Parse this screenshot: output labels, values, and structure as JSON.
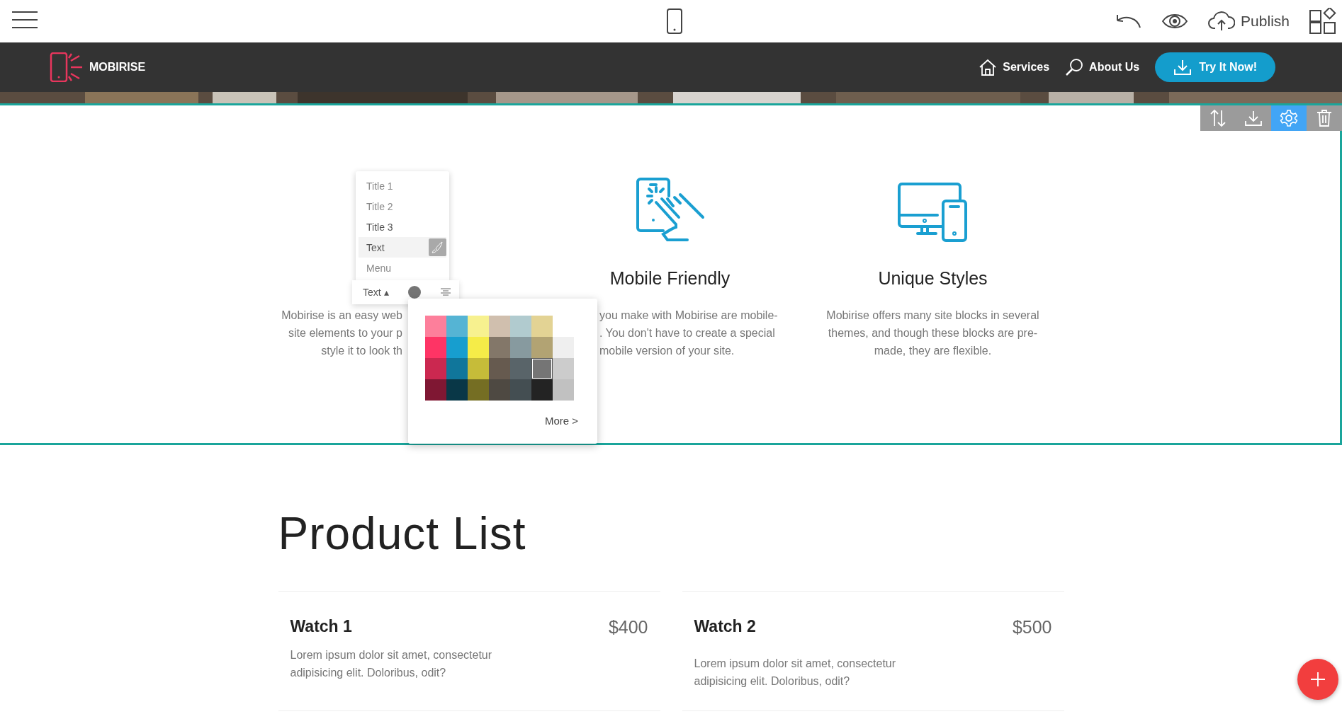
{
  "editor_bar": {
    "publish": "Publish"
  },
  "site_nav": {
    "brand": "MOBIRISE",
    "links": [
      {
        "label": "Services"
      },
      {
        "label": "About Us"
      }
    ],
    "cta": "Try It Now!"
  },
  "block_toolbar": [
    {
      "kind": "move",
      "selected": false
    },
    {
      "kind": "save",
      "selected": false
    },
    {
      "kind": "settings",
      "selected": true
    },
    {
      "kind": "delete",
      "selected": false
    }
  ],
  "style_menu": [
    {
      "label": "Title 1",
      "selected": false
    },
    {
      "label": "Title 2",
      "selected": false
    },
    {
      "label": "Title 3",
      "selected": false
    },
    {
      "label": "Text",
      "selected": true
    },
    {
      "label": "Menu",
      "selected": false
    }
  ],
  "text_toolbar": {
    "style": "Text ▴",
    "color": "#757575"
  },
  "palette": {
    "rows": [
      [
        {
          "color": "#fd7f9b",
          "selected": false
        },
        {
          "color": "#55b4d4",
          "selected": false
        },
        {
          "color": "#f7f18f",
          "selected": false
        },
        {
          "color": "#d0bfae",
          "selected": false
        },
        {
          "color": "#b1cbcf",
          "selected": false
        },
        {
          "color": "#e3d394",
          "selected": false
        }
      ],
      [
        {
          "color": "#fe3465",
          "selected": false
        },
        {
          "color": "#179ecf",
          "selected": false
        },
        {
          "color": "#f5ec48",
          "selected": false
        },
        {
          "color": "#837769",
          "selected": false
        },
        {
          "color": "#879a9f",
          "selected": false
        },
        {
          "color": "#b2a373",
          "selected": false
        },
        {
          "color": "#efefef",
          "selected": false
        }
      ],
      [
        {
          "color": "#cb2850",
          "selected": false
        },
        {
          "color": "#10769b",
          "selected": false
        },
        {
          "color": "#c6bc39",
          "selected": false
        },
        {
          "color": "#665a4f",
          "selected": false
        },
        {
          "color": "#596469",
          "selected": false
        },
        {
          "color": "#757575",
          "selected": true
        },
        {
          "color": "#cccccc",
          "selected": false
        }
      ],
      [
        {
          "color": "#7f1733",
          "selected": false
        },
        {
          "color": "#093747",
          "selected": false
        },
        {
          "color": "#756e23",
          "selected": false
        },
        {
          "color": "#4e4942",
          "selected": false
        },
        {
          "color": "#444e52",
          "selected": false
        },
        {
          "color": "#232323",
          "selected": false
        },
        {
          "color": "#c1c1c1",
          "selected": false
        }
      ]
    ],
    "more": "More >"
  },
  "features": [
    {
      "lines": [
        "Mobirise is an easy web",
        "site elements to your p",
        "style it to look th"
      ]
    },
    {
      "title": "Mobile Friendly",
      "lines": [
        "you make with Mobirise are mobile-",
        ". You don't have to create a special",
        "mobile version of your site."
      ]
    },
    {
      "title": "Unique Styles",
      "lines": [
        "Mobirise offers many site blocks in several",
        "themes, and though these blocks are pre-",
        "made, they are flexible."
      ]
    }
  ],
  "products": {
    "title": "Product List",
    "items": [
      {
        "name": "Watch 1",
        "price": "$400",
        "description": "Lorem ipsum dolor sit amet, consectetur adipisicing elit. Doloribus, odit?"
      },
      {
        "name": "Watch 2",
        "price": "$500",
        "description": "Lorem ipsum dolor sit amet, consectetur adipisicing elit. Doloribus, odit?"
      }
    ]
  }
}
